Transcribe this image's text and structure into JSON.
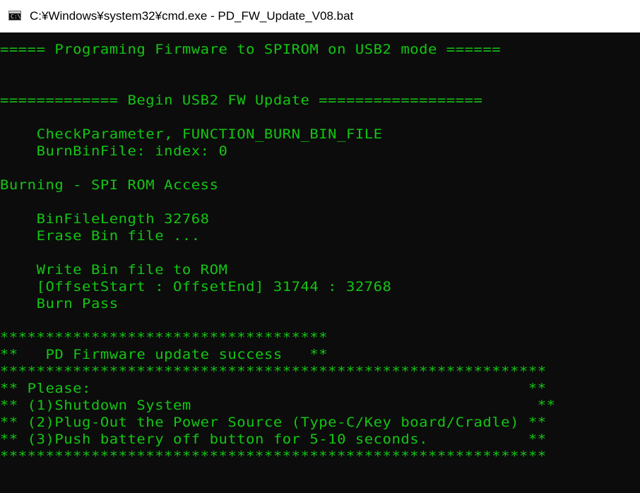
{
  "titlebar": {
    "icon": "cmd-icon",
    "icon_glyph": "C:\\",
    "title": "C:¥Windows¥system32¥cmd.exe - PD_FW_Update_V08.bat"
  },
  "console": {
    "text_color": "#13c613",
    "background_color": "#0c0c0c",
    "lines": [
      "===== Programing Firmware to SPIROM on USB2 mode ======",
      "",
      "",
      "============= Begin USB2 FW Update ==================",
      "",
      "    CheckParameter, FUNCTION_BURN_BIN_FILE",
      "    BurnBinFile: index: 0",
      "",
      "Burning - SPI ROM Access",
      "",
      "    BinFileLength 32768",
      "    Erase Bin file ...",
      "",
      "    Write Bin file to ROM",
      "    [OffsetStart : OffsetEnd] 31744 : 32768",
      "    Burn Pass",
      "",
      "************************************",
      "**   PD Firmware update success   **",
      "************************************************************",
      "** Please:                                                **",
      "** (1)Shutdown System                                      **",
      "** (2)Plug-Out the Power Source (Type-C/Key board/Cradle) **",
      "** (3)Push battery off button for 5-10 seconds.           **",
      "************************************************************"
    ]
  }
}
